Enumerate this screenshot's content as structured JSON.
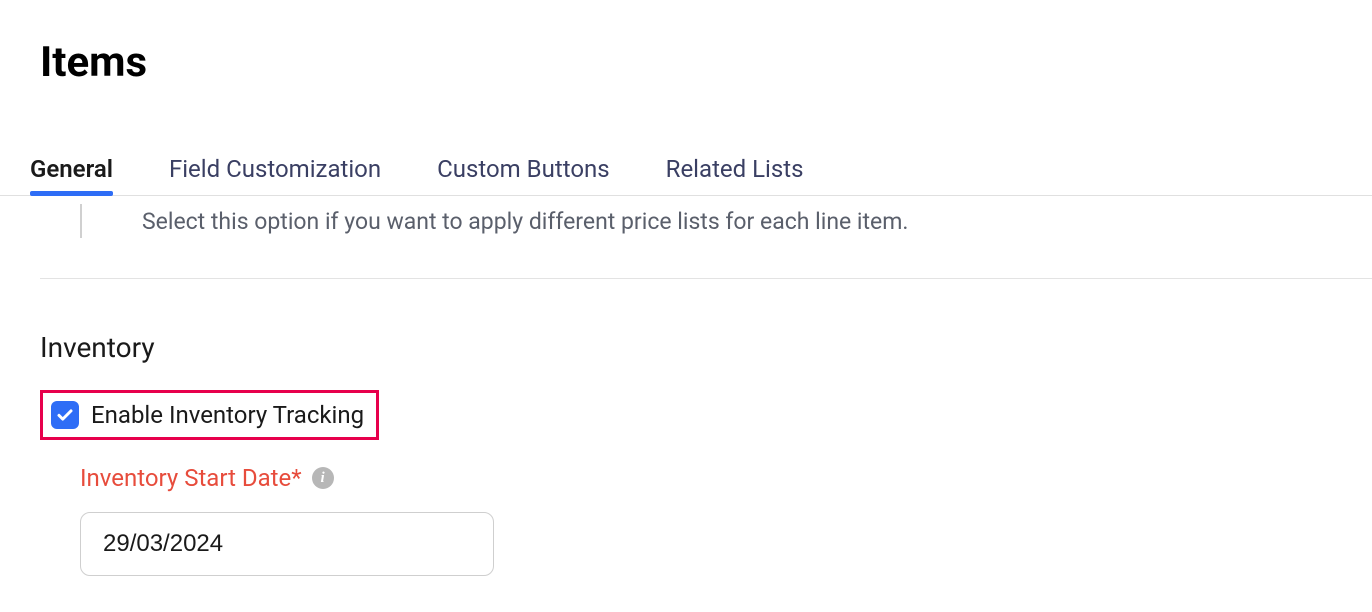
{
  "page": {
    "title": "Items"
  },
  "tabs": {
    "general": "General",
    "field_customization": "Field Customization",
    "custom_buttons": "Custom Buttons",
    "related_lists": "Related Lists"
  },
  "helper": {
    "price_list_text": "Select this option if you want to apply different price lists for each line item."
  },
  "inventory": {
    "section_title": "Inventory",
    "enable_tracking_label": "Enable Inventory Tracking",
    "enable_tracking_checked": true,
    "start_date_label": "Inventory Start Date*",
    "start_date_value": "29/03/2024"
  }
}
